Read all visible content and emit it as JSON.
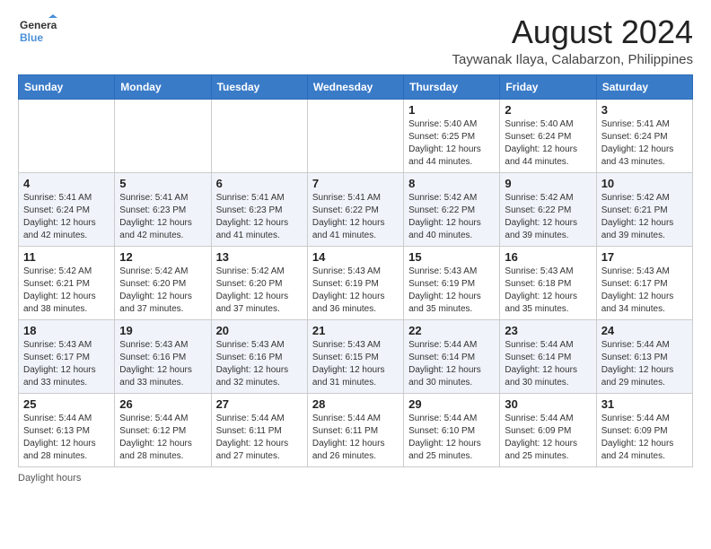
{
  "logo": {
    "line1": "General",
    "line2": "Blue"
  },
  "title": "August 2024",
  "subtitle": "Taywanak Ilaya, Calabarzon, Philippines",
  "days_of_week": [
    "Sunday",
    "Monday",
    "Tuesday",
    "Wednesday",
    "Thursday",
    "Friday",
    "Saturday"
  ],
  "footer": "Daylight hours",
  "weeks": [
    [
      {
        "day": "",
        "info": ""
      },
      {
        "day": "",
        "info": ""
      },
      {
        "day": "",
        "info": ""
      },
      {
        "day": "",
        "info": ""
      },
      {
        "day": "1",
        "info": "Sunrise: 5:40 AM\nSunset: 6:25 PM\nDaylight: 12 hours\nand 44 minutes."
      },
      {
        "day": "2",
        "info": "Sunrise: 5:40 AM\nSunset: 6:24 PM\nDaylight: 12 hours\nand 44 minutes."
      },
      {
        "day": "3",
        "info": "Sunrise: 5:41 AM\nSunset: 6:24 PM\nDaylight: 12 hours\nand 43 minutes."
      }
    ],
    [
      {
        "day": "4",
        "info": "Sunrise: 5:41 AM\nSunset: 6:24 PM\nDaylight: 12 hours\nand 42 minutes."
      },
      {
        "day": "5",
        "info": "Sunrise: 5:41 AM\nSunset: 6:23 PM\nDaylight: 12 hours\nand 42 minutes."
      },
      {
        "day": "6",
        "info": "Sunrise: 5:41 AM\nSunset: 6:23 PM\nDaylight: 12 hours\nand 41 minutes."
      },
      {
        "day": "7",
        "info": "Sunrise: 5:41 AM\nSunset: 6:22 PM\nDaylight: 12 hours\nand 41 minutes."
      },
      {
        "day": "8",
        "info": "Sunrise: 5:42 AM\nSunset: 6:22 PM\nDaylight: 12 hours\nand 40 minutes."
      },
      {
        "day": "9",
        "info": "Sunrise: 5:42 AM\nSunset: 6:22 PM\nDaylight: 12 hours\nand 39 minutes."
      },
      {
        "day": "10",
        "info": "Sunrise: 5:42 AM\nSunset: 6:21 PM\nDaylight: 12 hours\nand 39 minutes."
      }
    ],
    [
      {
        "day": "11",
        "info": "Sunrise: 5:42 AM\nSunset: 6:21 PM\nDaylight: 12 hours\nand 38 minutes."
      },
      {
        "day": "12",
        "info": "Sunrise: 5:42 AM\nSunset: 6:20 PM\nDaylight: 12 hours\nand 37 minutes."
      },
      {
        "day": "13",
        "info": "Sunrise: 5:42 AM\nSunset: 6:20 PM\nDaylight: 12 hours\nand 37 minutes."
      },
      {
        "day": "14",
        "info": "Sunrise: 5:43 AM\nSunset: 6:19 PM\nDaylight: 12 hours\nand 36 minutes."
      },
      {
        "day": "15",
        "info": "Sunrise: 5:43 AM\nSunset: 6:19 PM\nDaylight: 12 hours\nand 35 minutes."
      },
      {
        "day": "16",
        "info": "Sunrise: 5:43 AM\nSunset: 6:18 PM\nDaylight: 12 hours\nand 35 minutes."
      },
      {
        "day": "17",
        "info": "Sunrise: 5:43 AM\nSunset: 6:17 PM\nDaylight: 12 hours\nand 34 minutes."
      }
    ],
    [
      {
        "day": "18",
        "info": "Sunrise: 5:43 AM\nSunset: 6:17 PM\nDaylight: 12 hours\nand 33 minutes."
      },
      {
        "day": "19",
        "info": "Sunrise: 5:43 AM\nSunset: 6:16 PM\nDaylight: 12 hours\nand 33 minutes."
      },
      {
        "day": "20",
        "info": "Sunrise: 5:43 AM\nSunset: 6:16 PM\nDaylight: 12 hours\nand 32 minutes."
      },
      {
        "day": "21",
        "info": "Sunrise: 5:43 AM\nSunset: 6:15 PM\nDaylight: 12 hours\nand 31 minutes."
      },
      {
        "day": "22",
        "info": "Sunrise: 5:44 AM\nSunset: 6:14 PM\nDaylight: 12 hours\nand 30 minutes."
      },
      {
        "day": "23",
        "info": "Sunrise: 5:44 AM\nSunset: 6:14 PM\nDaylight: 12 hours\nand 30 minutes."
      },
      {
        "day": "24",
        "info": "Sunrise: 5:44 AM\nSunset: 6:13 PM\nDaylight: 12 hours\nand 29 minutes."
      }
    ],
    [
      {
        "day": "25",
        "info": "Sunrise: 5:44 AM\nSunset: 6:13 PM\nDaylight: 12 hours\nand 28 minutes."
      },
      {
        "day": "26",
        "info": "Sunrise: 5:44 AM\nSunset: 6:12 PM\nDaylight: 12 hours\nand 28 minutes."
      },
      {
        "day": "27",
        "info": "Sunrise: 5:44 AM\nSunset: 6:11 PM\nDaylight: 12 hours\nand 27 minutes."
      },
      {
        "day": "28",
        "info": "Sunrise: 5:44 AM\nSunset: 6:11 PM\nDaylight: 12 hours\nand 26 minutes."
      },
      {
        "day": "29",
        "info": "Sunrise: 5:44 AM\nSunset: 6:10 PM\nDaylight: 12 hours\nand 25 minutes."
      },
      {
        "day": "30",
        "info": "Sunrise: 5:44 AM\nSunset: 6:09 PM\nDaylight: 12 hours\nand 25 minutes."
      },
      {
        "day": "31",
        "info": "Sunrise: 5:44 AM\nSunset: 6:09 PM\nDaylight: 12 hours\nand 24 minutes."
      }
    ]
  ]
}
